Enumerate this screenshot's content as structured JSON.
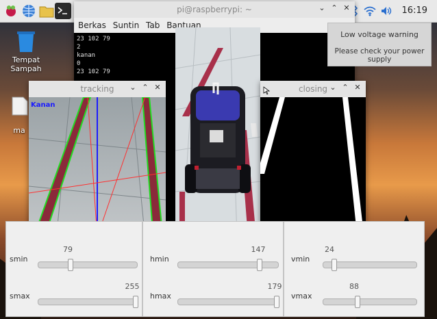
{
  "taskbar": {
    "icons": [
      "raspberry-icon",
      "web-browser-icon",
      "file-manager-icon",
      "terminal-icon"
    ],
    "clock": "16:19",
    "tray_icons": [
      "bluetooth-icon",
      "wifi-icon",
      "volume-icon"
    ]
  },
  "desktop": {
    "trash_label_line1": "Tempat",
    "trash_label_line2": "Sampah",
    "file_label": "ma"
  },
  "terminal": {
    "title": "pi@raspberrypi: ~",
    "menu": [
      "Berkas",
      "Suntin",
      "Tab",
      "Bantuan"
    ],
    "lines": [
      "23 102 79",
      "2",
      "kanan",
      "0",
      "23 102 79"
    ]
  },
  "notification": {
    "title": "Low voltage warning",
    "message": "Please check your power supply"
  },
  "tracking": {
    "title": "tracking",
    "overlay_label": "Kanan"
  },
  "closing": {
    "title": "closing"
  },
  "trackbars": {
    "smin": {
      "label": "smin",
      "value": "79",
      "fraction": 0.31
    },
    "smax": {
      "label": "smax",
      "value": "255",
      "fraction": 1.0
    },
    "hmin": {
      "label": "hmin",
      "value": "147",
      "fraction": 0.82
    },
    "hmax": {
      "label": "hmax",
      "value": "179",
      "fraction": 1.0
    },
    "vmin": {
      "label": "vmin",
      "value": "24",
      "fraction": 0.09
    },
    "vmax": {
      "label": "vmax",
      "value": "88",
      "fraction": 0.35
    }
  }
}
